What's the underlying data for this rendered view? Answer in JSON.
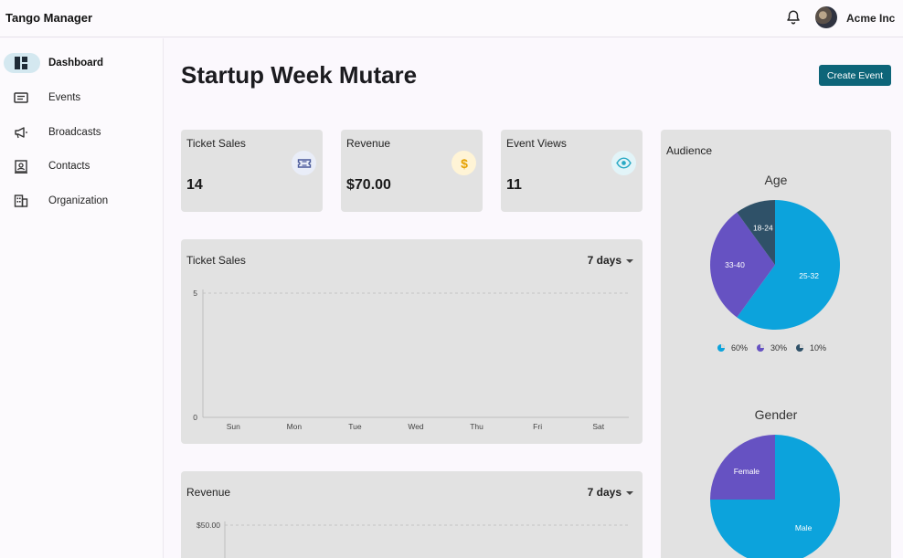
{
  "app": {
    "title": "Tango Manager",
    "org_name": "Acme Inc"
  },
  "sidebar": {
    "items": [
      {
        "label": "Dashboard",
        "icon": "dashboard-icon",
        "active": true
      },
      {
        "label": "Events",
        "icon": "events-icon"
      },
      {
        "label": "Broadcasts",
        "icon": "megaphone-icon"
      },
      {
        "label": "Contacts",
        "icon": "contacts-icon"
      },
      {
        "label": "Organization",
        "icon": "building-icon"
      }
    ]
  },
  "page": {
    "title": "Startup Week Mutare",
    "create_button": "Create Event"
  },
  "stats": [
    {
      "label": "Ticket Sales",
      "value": "14",
      "icon": "ticket-icon",
      "icon_color": "#4a5a9a",
      "icon_bg": "#e9edf8"
    },
    {
      "label": "Revenue",
      "value": "$70.00",
      "icon": "dollar-icon",
      "icon_color": "#e5a100",
      "icon_bg": "#fff4d6"
    },
    {
      "label": "Event Views",
      "value": "11",
      "icon": "eye-icon",
      "icon_color": "#29a9c4",
      "icon_bg": "#e2f4f8"
    }
  ],
  "charts": {
    "ticket_sales": {
      "title": "Ticket Sales",
      "range": "7 days"
    },
    "revenue": {
      "title": "Revenue",
      "range": "7 days"
    }
  },
  "audience": {
    "title": "Audience",
    "age_title": "Age",
    "gender_title": "Gender",
    "legend": [
      "60%",
      "30%",
      "10%"
    ]
  },
  "colors": {
    "accent": "#0d6579",
    "slice_primary": "#0ca3dc",
    "slice_secondary": "#6652c2",
    "slice_tertiary": "#2f5168"
  },
  "chart_data": [
    {
      "type": "line",
      "title": "Ticket Sales",
      "categories": [
        "Sun",
        "Mon",
        "Tue",
        "Wed",
        "Thu",
        "Fri",
        "Sat"
      ],
      "y_ticks": [
        "0",
        "5"
      ],
      "ylim": [
        0,
        5
      ],
      "series": [],
      "grid": true
    },
    {
      "type": "line",
      "title": "Revenue",
      "y_ticks": [
        "$50.00"
      ],
      "series": [],
      "grid": true
    },
    {
      "type": "pie",
      "title": "Age",
      "slices": [
        {
          "label": "25-32",
          "value": 60,
          "color": "#0ca3dc"
        },
        {
          "label": "33-40",
          "value": 30,
          "color": "#6652c2"
        },
        {
          "label": "18-24",
          "value": 10,
          "color": "#2f5168"
        }
      ]
    },
    {
      "type": "pie",
      "title": "Gender",
      "slices": [
        {
          "label": "Male",
          "value": 75,
          "color": "#0ca3dc"
        },
        {
          "label": "Female",
          "value": 25,
          "color": "#6652c2"
        }
      ]
    }
  ]
}
